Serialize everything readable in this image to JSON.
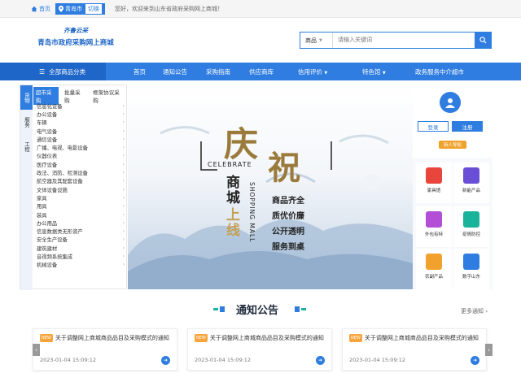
{
  "topbar": {
    "home": "首页",
    "city": "青岛市",
    "switch": "切换",
    "welcome": "您好，欢迎来到山东省政府采购网上商城！"
  },
  "logo": {
    "slogan": "齐鲁云采",
    "name": "青岛市政府采购网上商城"
  },
  "search": {
    "category": "商品",
    "placeholder": "请输入关键词"
  },
  "nav": {
    "all_categories": "全部商品分类",
    "items": [
      "首页",
      "通知公告",
      "采购指南",
      "供应商库",
      "信用评价",
      "特色馆",
      "政务服务中介超市"
    ]
  },
  "left": {
    "vtabs": [
      "货物",
      "服务",
      "工程"
    ],
    "htabs": [
      "超市采购",
      "批量采购",
      "框架协议采购"
    ],
    "categories": [
      "信息化设备",
      "办公设备",
      "车辆",
      "电气设备",
      "通信设备",
      "广播、电视、电影设备",
      "仪器仪表",
      "医疗设备",
      "政法、消防、检测设备",
      "航空器及其配套设备",
      "文体设备设施",
      "家具",
      "用具",
      "装具",
      "办公用品",
      "信息数据类无形资产",
      "安全生产设备",
      "建筑建材",
      "音视频系统集成",
      "机械设备"
    ]
  },
  "banner": {
    "big1": "庆",
    "big2": "祝",
    "celebrate": "CELEBRATE",
    "mall_cn": [
      "商",
      "城"
    ],
    "online": [
      "上",
      "线"
    ],
    "mall_en": "SHOPPING MALL",
    "slogans": [
      "商品齐全",
      "质优价廉",
      "公开透明",
      "服务到桌"
    ]
  },
  "right": {
    "login": "登录",
    "register": "注册",
    "newbie": "新人导航",
    "services": [
      "家具馆",
      "新能产品",
      "外包有特",
      "疫情防控",
      "农副产品",
      "数字山东"
    ]
  },
  "notice": {
    "title": "通知公告",
    "more": "更多通知 ›",
    "cards": [
      {
        "tag": "NEW",
        "title": "关于调整网上商城商品品目及采购模式的通知",
        "date": "2023-01-04 15:09:12"
      },
      {
        "tag": "NEW",
        "title": "关于调整网上商城商品品目及采购模式的通知",
        "date": "2023-01-04 15:09:12"
      },
      {
        "tag": "NEW",
        "title": "关于调整网上商城商品品目及采购模式的通知",
        "date": "2023-01-04 15:09:12"
      }
    ]
  },
  "colors": {
    "primary": "#2f7de0",
    "primary_dark": "#1e66c8",
    "accent": "#f0a22d"
  }
}
